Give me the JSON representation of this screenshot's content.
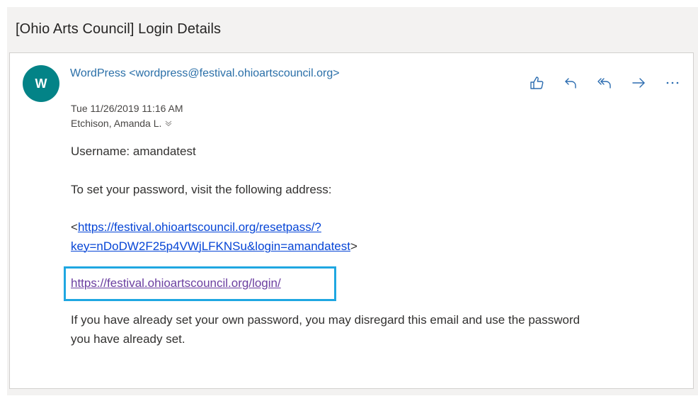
{
  "email": {
    "subject": "[Ohio Arts Council] Login Details",
    "avatar_initial": "W",
    "sender": "WordPress <wordpress@festival.ohioartscouncil.org>",
    "date": "Tue 11/26/2019 11:16 AM",
    "recipient": "Etchison, Amanda L."
  },
  "actions": {
    "like_icon": "thumbs-up-icon",
    "reply_icon": "reply-icon",
    "reply_all_icon": "reply-all-icon",
    "forward_icon": "forward-icon",
    "more_icon": "more-icon"
  },
  "body": {
    "username_line": "Username: amandatest",
    "instruction": "To set your password, visit the following address:",
    "reset_open": "<",
    "reset_link_line1": "https://festival.ohioartscouncil.org/resetpass/?",
    "reset_link_line2": "key=nDoDW2F25p4VWjLFKNSu&login=amandatest",
    "reset_close": ">",
    "login_link": "https://festival.ohioartscouncil.org/login/",
    "disclaimer_line1": "If you have already set your own password, you may disregard this email and use the password",
    "disclaimer_line2": "you have already set."
  },
  "colors": {
    "avatar": "#038387",
    "sender": "#2a6fa8",
    "link": "#0645d6",
    "visited_link": "#6b3fa0",
    "highlight_border": "#1fa7e1"
  }
}
